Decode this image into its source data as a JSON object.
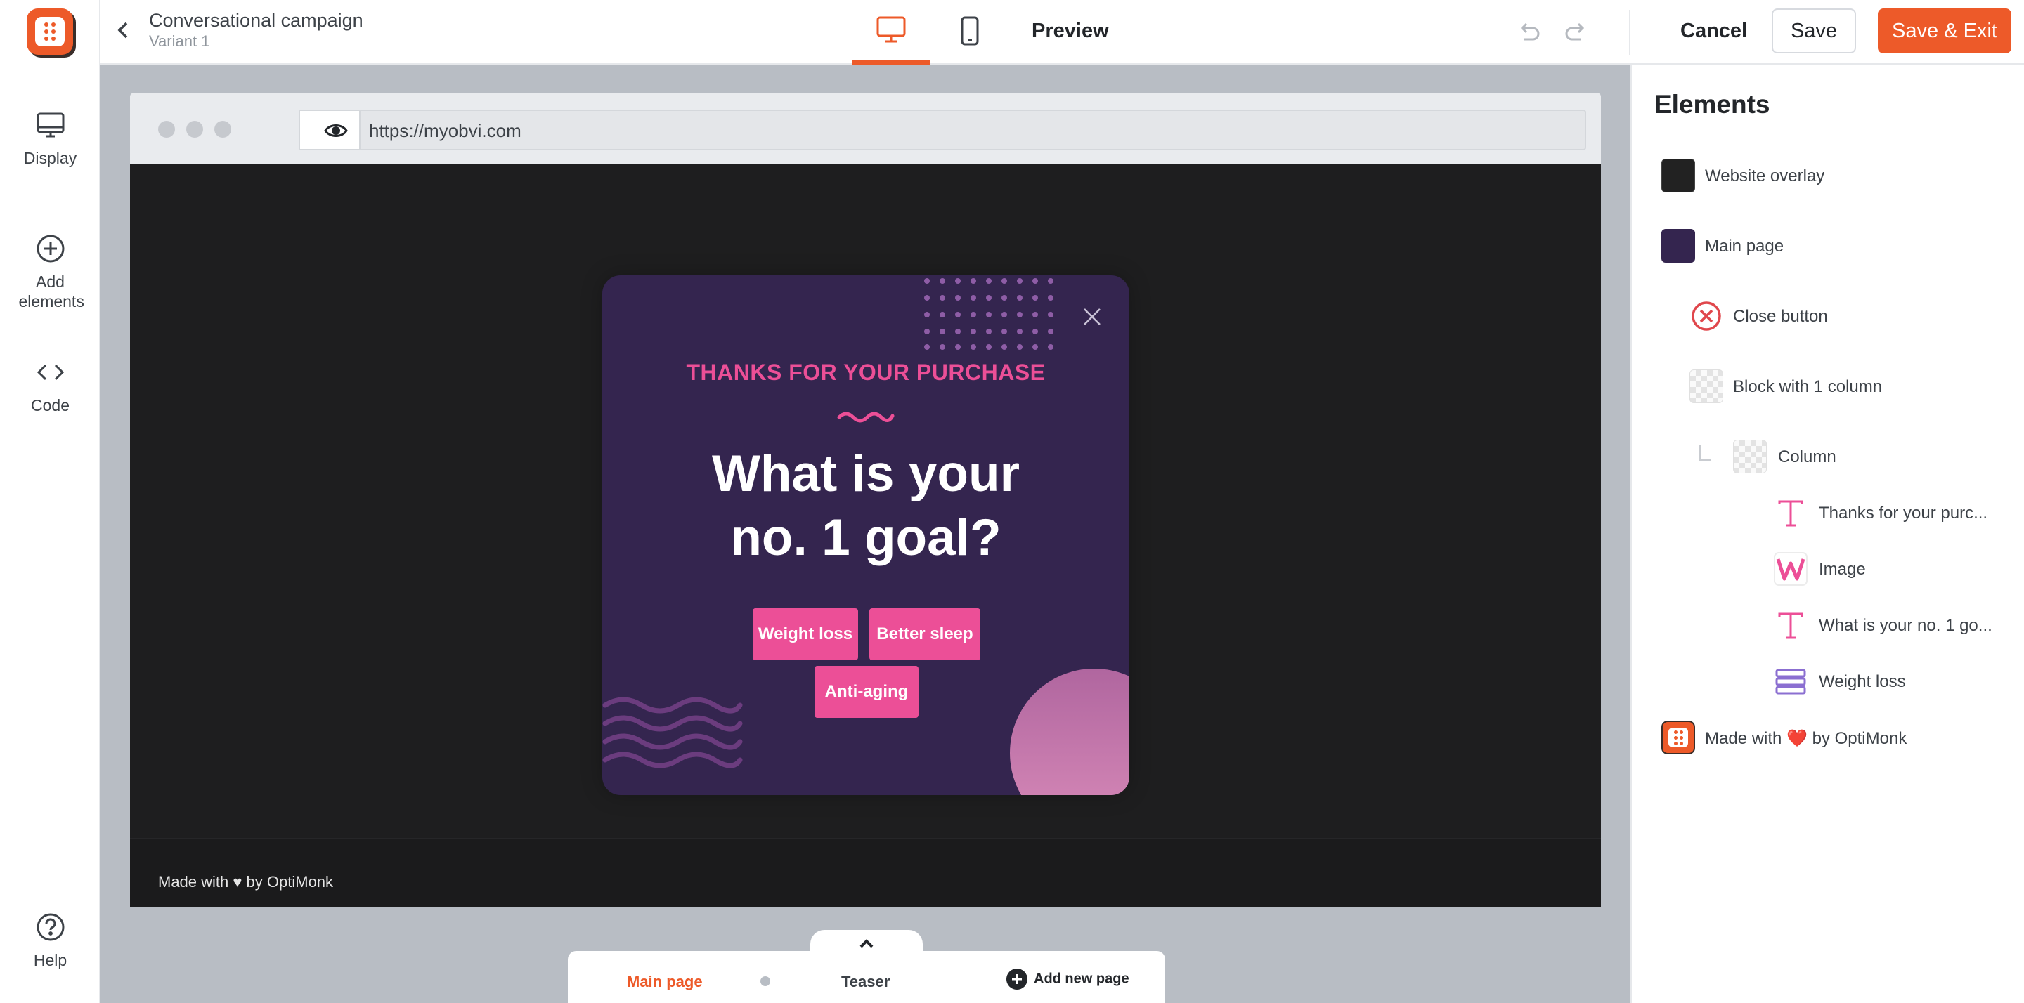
{
  "app": {
    "campaign_title": "Conversational campaign",
    "variant": "Variant 1"
  },
  "left_nav": {
    "items": [
      {
        "label": "Display",
        "icon": "monitor-icon"
      },
      {
        "label": "Add elements",
        "icon": "plus-circle-icon"
      },
      {
        "label": "Code",
        "icon": "code-icon"
      }
    ],
    "help": {
      "label": "Help",
      "icon": "help-icon"
    }
  },
  "toolbar": {
    "preview_label": "Preview",
    "cancel_label": "Cancel",
    "save_label": "Save",
    "save_exit_label": "Save & Exit",
    "active_device": "desktop"
  },
  "browser": {
    "url": "https://myobvi.com"
  },
  "popup": {
    "subtitle": "THANKS FOR YOUR PURCHASE",
    "heading_line1": "What is your",
    "heading_line2": "no. 1 goal?",
    "choices": [
      "Weight loss",
      "Better sleep",
      "Anti-aging"
    ],
    "accent": "#ec4f97",
    "background": "#34254f"
  },
  "site_footer": {
    "made_with": "Made with ♥ by OptiMonk"
  },
  "pages": {
    "tabs": [
      "Main page",
      "Teaser"
    ],
    "active": "Main page",
    "add_label": "Add new page"
  },
  "elements_panel": {
    "title": "Elements",
    "items": [
      {
        "label": "Website overlay",
        "icon": "overlay-swatch-icon"
      },
      {
        "label": "Main page",
        "icon": "page-swatch-icon"
      },
      {
        "label": "Close button",
        "icon": "close-circle-icon"
      },
      {
        "label": "Block with 1 column",
        "icon": "block-icon"
      },
      {
        "label": "Column",
        "icon": "column-icon"
      },
      {
        "label": "Thanks for your purc...",
        "icon": "text-icon"
      },
      {
        "label": "Image",
        "icon": "image-icon"
      },
      {
        "label": "What is your no. 1 go...",
        "icon": "text-icon"
      },
      {
        "label": "Weight loss",
        "icon": "buttons-icon"
      },
      {
        "label": "Made with ❤️ by OptiMonk",
        "icon": "optimonk-logo-icon"
      }
    ]
  },
  "colors": {
    "brand": "#ed5a29",
    "canvas_bg": "#b8bdc4",
    "site_bg": "#1e1e1f"
  }
}
